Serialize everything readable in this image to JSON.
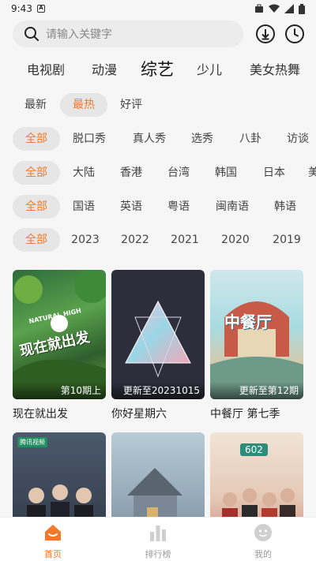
{
  "status_bar": {
    "time": "9:43",
    "a_badge": "A"
  },
  "search": {
    "placeholder": "请输入关键字"
  },
  "categories": [
    "电视剧",
    "动漫",
    "综艺",
    "少儿",
    "美女热舞"
  ],
  "active_category": "综艺",
  "sort": [
    "最新",
    "最热",
    "好评"
  ],
  "active_sort": "最热",
  "filters": {
    "type": [
      "全部",
      "脱口秀",
      "真人秀",
      "选秀",
      "八卦",
      "访谈"
    ],
    "region": [
      "全部",
      "大陆",
      "香港",
      "台湾",
      "韩国",
      "日本",
      "美"
    ],
    "language": [
      "全部",
      "国语",
      "英语",
      "粤语",
      "闽南语",
      "韩语"
    ],
    "year": [
      "全部",
      "2023",
      "2022",
      "2021",
      "2020",
      "2019"
    ]
  },
  "cards": [
    {
      "title": "现在就出发",
      "caption": "第10期上"
    },
    {
      "title": "你好星期六",
      "caption": "更新至20231015"
    },
    {
      "title": "中餐厅 第七季",
      "caption": "更新至第12期"
    },
    {
      "title": "",
      "caption": ""
    },
    {
      "title": "",
      "caption": ""
    },
    {
      "title": "",
      "caption": ""
    }
  ],
  "poster_text": {
    "card0_line1": "NATURAL HIGH",
    "card0_line2": "现在就出发",
    "card2_line1": "中餐厅",
    "card3_badge": "腾讯视频",
    "card5_badge": "602"
  },
  "bottom_nav": [
    {
      "label": "首页",
      "icon": "home-icon"
    },
    {
      "label": "排行榜",
      "icon": "ranking-icon"
    },
    {
      "label": "我的",
      "icon": "profile-icon"
    }
  ],
  "colors": {
    "accent": "#f07a2a",
    "chip_bg": "#e6e6e6",
    "page_bg": "#f6f6f6"
  }
}
